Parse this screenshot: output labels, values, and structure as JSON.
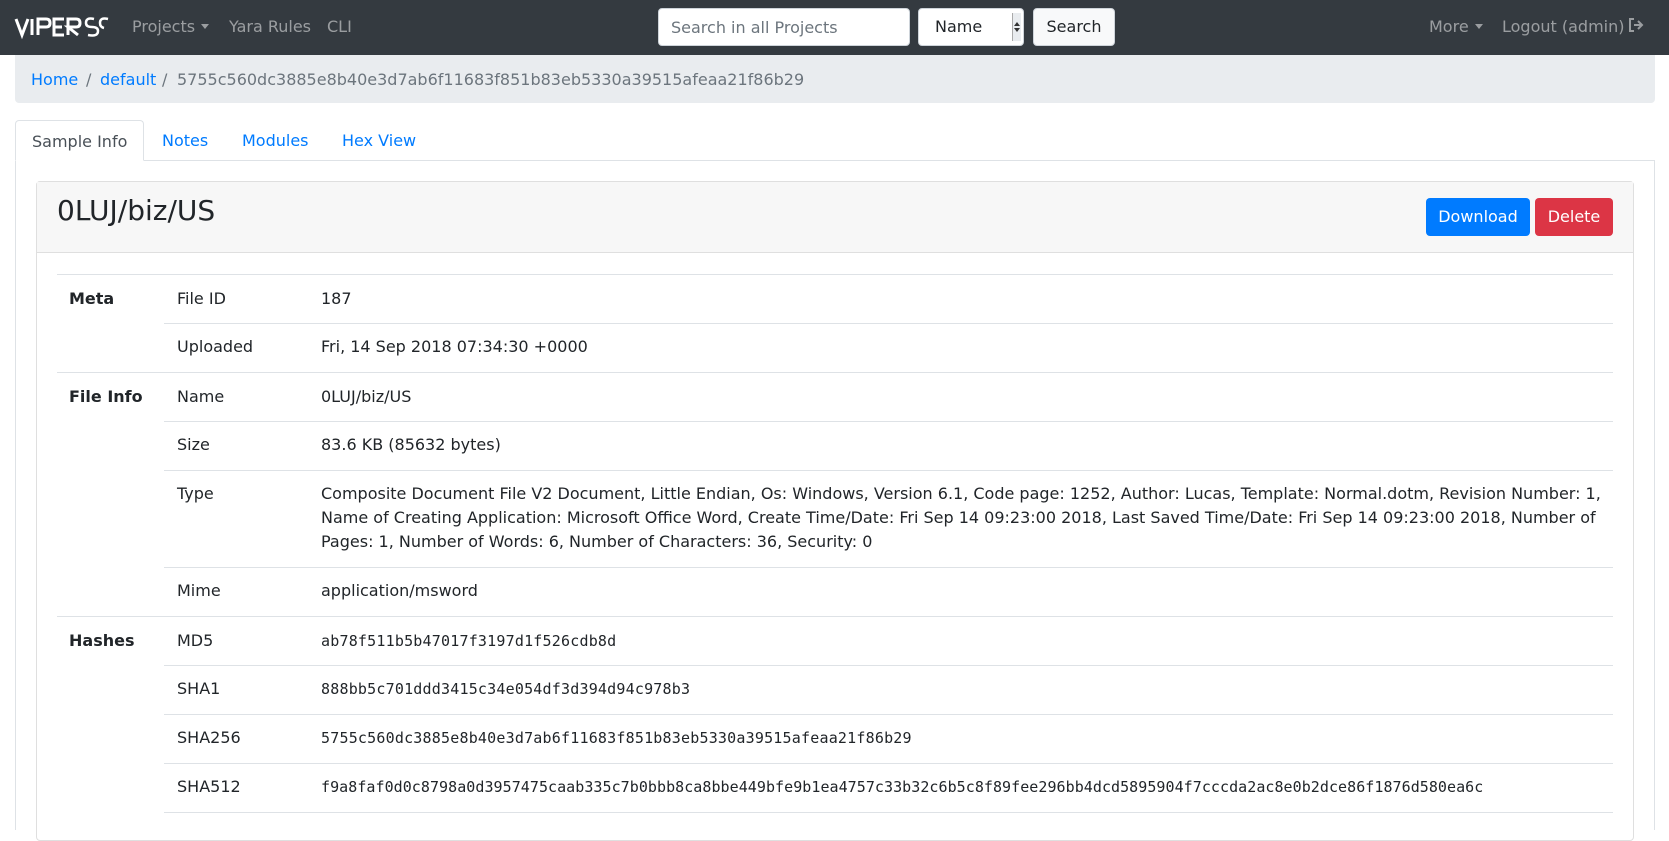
{
  "navbar": {
    "brand": "VIPER",
    "projects_label": "Projects",
    "yara_label": "Yara Rules",
    "cli_label": "CLI",
    "search_placeholder": "Search in all Projects",
    "search_field_value": "Name",
    "search_button": "Search",
    "more_label": "More",
    "logout_label": "Logout (admin)"
  },
  "breadcrumb": {
    "home": "Home",
    "project": "default",
    "separator": "/",
    "current": "5755c560dc3885e8b40e3d7ab6f11683f851b83eb5330a39515afeaa21f86b29"
  },
  "tabs": [
    {
      "label": "Sample Info",
      "active": true
    },
    {
      "label": "Notes"
    },
    {
      "label": "Modules"
    },
    {
      "label": "Hex View"
    }
  ],
  "card": {
    "title": "0LUJ/biz/US",
    "download_label": "Download",
    "delete_label": "Delete"
  },
  "info": {
    "meta": {
      "label": "Meta",
      "file_id_key": "File ID",
      "file_id": "187",
      "uploaded_key": "Uploaded",
      "uploaded": "Fri, 14 Sep 2018 07:34:30 +0000"
    },
    "file_info": {
      "label": "File Info",
      "name_key": "Name",
      "name": "0LUJ/biz/US",
      "size_key": "Size",
      "size": "83.6 KB (85632 bytes)",
      "type_key": "Type",
      "type_line1": "Composite Document File V2 Document, Little Endian, Os: Windows, Version 6.1, Code page: 1252, Author: Lucas, Template: Normal.dotm, Revision Number: 1,",
      "type_line2": "Name of Creating Application: Microsoft Office Word, Create Time/Date: Fri Sep 14 09:23:00 2018, Last Saved Time/Date: Fri Sep 14 09:23:00 2018, Number of",
      "type_line3": "Pages: 1, Number of Words: 6, Number of Characters: 36, Security: 0",
      "mime_key": "Mime",
      "mime": "application/msword"
    },
    "hashes": {
      "label": "Hashes",
      "md5_key": "MD5",
      "md5": "ab78f511b5b47017f3197d1f526cdb8d",
      "sha1_key": "SHA1",
      "sha1": "888bb5c701ddd3415c34e054df3d394d94c978b3",
      "sha256_key": "SHA256",
      "sha256": "5755c560dc3885e8b40e3d7ab6f11683f851b83eb5330a39515afeaa21f86b29",
      "sha512_key": "SHA512",
      "sha512": "f9a8faf0d0c8798a0d3957475caab335c7b0bbb8ca8bbe449bfe9b1ea4757c33b32c6b5c8f89fee296bb4dcd5895904f7cccda2ac8e0b2dce86f1876d580ea6c"
    }
  }
}
